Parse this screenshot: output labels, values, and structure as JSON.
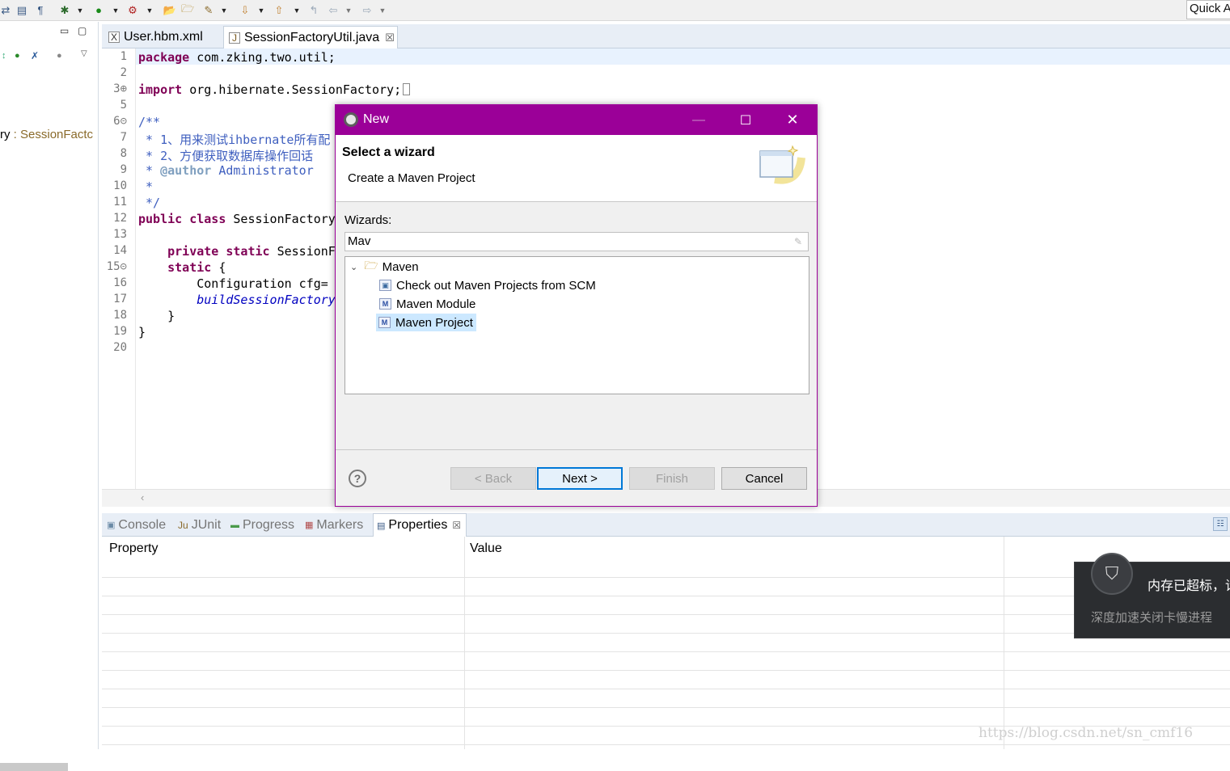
{
  "toolbar": {
    "quick_access": "Quick A"
  },
  "left_panel": {
    "outline_item_prefix": "ry",
    "outline_item_sep": " : ",
    "outline_item_type": "SessionFactc"
  },
  "editor": {
    "tabs": [
      {
        "label": "User.hbm.xml",
        "active": false
      },
      {
        "label": "SessionFactoryUtil.java",
        "active": true,
        "close": "☒"
      }
    ],
    "line_numbers": [
      "1",
      "2",
      "3⊕",
      "5",
      "6⊝",
      "7",
      "8",
      "9",
      "10",
      "11",
      "12",
      "13",
      "14",
      "15⊝",
      "16",
      "17",
      "18",
      "19",
      "20"
    ],
    "lines": {
      "l1_kw": "package",
      "l1_rest": " com.zking.two.util;",
      "l3_kw": "import",
      "l3_rest": " org.hibernate.SessionFactory;",
      "l6": "/**",
      "l7": " * 1、用来测试ihbernate所有配",
      "l8": " * 2、方便获取数据库操作回话",
      "l9_star": " * ",
      "l9_tag": "@author",
      "l9_rest": " Administrator",
      "l10": " *",
      "l11": " */",
      "l12_kw": "public class",
      "l12_rest": " SessionFactory",
      "l14_kw": "private static",
      "l14_rest": " SessionF",
      "l15_kw": "static",
      "l15_rest": " {",
      "l16": "        Configuration cfg=",
      "l17": "buildSessionFactory",
      "l18": "    }",
      "l19": "}"
    }
  },
  "bottom": {
    "tabs": [
      {
        "label": "Console",
        "icon": "console-icon"
      },
      {
        "label": "JUnit",
        "icon": "junit-icon",
        "prefix": "Ju"
      },
      {
        "label": "Progress",
        "icon": "progress-icon"
      },
      {
        "label": "Markers",
        "icon": "markers-icon"
      },
      {
        "label": "Properties",
        "icon": "properties-icon",
        "active": true
      }
    ],
    "columns": [
      "Property",
      "Value"
    ]
  },
  "notification": {
    "title": "内存已超标，请",
    "subtitle": "深度加速关闭卡慢进程"
  },
  "watermark": "https://blog.csdn.net/sn_cmf16",
  "dialog": {
    "title": "New",
    "header_title": "Select a wizard",
    "header_desc": "Create a Maven Project",
    "wizards_label": "Wizards:",
    "filter_value": "Mav",
    "tree": {
      "folder": "Maven",
      "items": [
        {
          "label": "Check out Maven Projects from SCM",
          "selected": false
        },
        {
          "label": "Maven Module",
          "selected": false
        },
        {
          "label": "Maven Project",
          "selected": true
        }
      ]
    },
    "buttons": {
      "back": "< Back",
      "next": "Next >",
      "finish": "Finish",
      "cancel": "Cancel",
      "help": "?"
    },
    "accent_color": "#9b0098"
  }
}
